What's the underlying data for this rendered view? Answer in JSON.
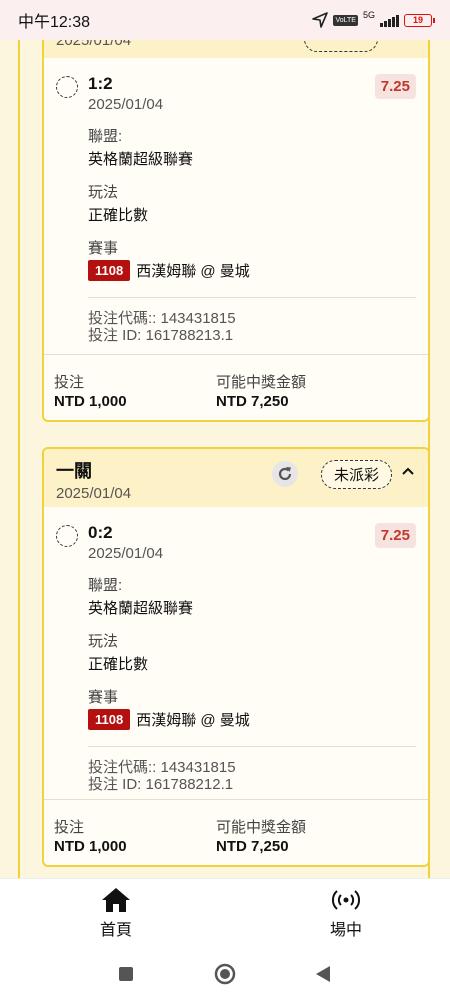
{
  "status_bar": {
    "time": "中午12:38",
    "network": "5G",
    "lte": "VoLTE",
    "battery": "19"
  },
  "card_top_partial": {
    "date": "2025/01/04"
  },
  "bets": [
    {
      "score": "1:2",
      "date": "2025/01/04",
      "odds": "7.25",
      "league_label": "聯盟:",
      "league": "英格蘭超級聯賽",
      "play_label": "玩法",
      "play": "正確比數",
      "match_label": "賽事",
      "match_id": "1108",
      "match_name": "西漢姆聯 @ 曼城",
      "bet_code": "投注代碼:: 143431815",
      "bet_id": "投注 ID: 161788213.1",
      "stake_label": "投注",
      "stake": "NTD 1,000",
      "payout_label": "可能中獎金額",
      "payout": "NTD 7,250"
    },
    {
      "header_title": "一關",
      "header_date": "2025/01/04",
      "status": "未派彩",
      "score": "0:2",
      "date": "2025/01/04",
      "odds": "7.25",
      "league_label": "聯盟:",
      "league": "英格蘭超級聯賽",
      "play_label": "玩法",
      "play": "正確比數",
      "match_label": "賽事",
      "match_id": "1108",
      "match_name": "西漢姆聯 @ 曼城",
      "bet_code": "投注代碼:: 143431815",
      "bet_id": "投注 ID: 161788212.1",
      "stake_label": "投注",
      "stake": "NTD 1,000",
      "payout_label": "可能中獎金額",
      "payout": "NTD 7,250"
    }
  ],
  "bottom_nav": {
    "home": "首頁",
    "live": "場中"
  },
  "icons": {
    "home": "home-icon",
    "live": "broadcast-icon",
    "refresh": "refresh-icon",
    "chevron": "chevron-up-icon"
  }
}
